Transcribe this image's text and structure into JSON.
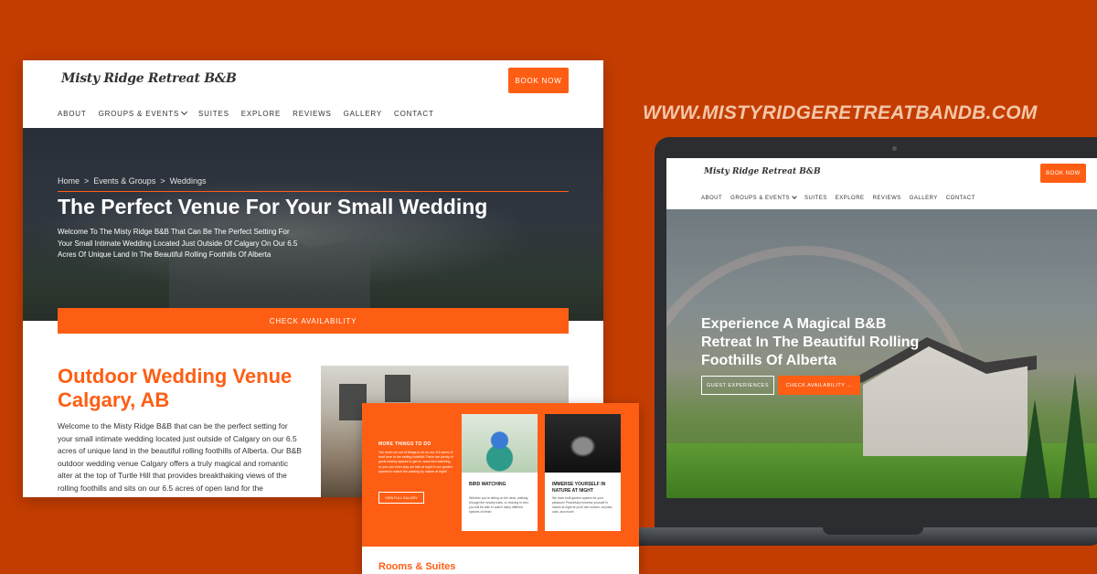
{
  "site_url": "WWW.MISTYRIDGERETREATBANDB.COM",
  "colors": {
    "background": "#c43d00",
    "accent": "#fe5e14",
    "url_text": "#f4c7a8"
  },
  "main_page": {
    "logo": "Misty Ridge Retreat B&B",
    "book_button": "BOOK NOW",
    "nav": [
      "ABOUT",
      "GROUPS & EVENTS",
      "SUITES",
      "EXPLORE",
      "REVIEWS",
      "GALLERY",
      "CONTACT"
    ],
    "breadcrumb": [
      "Home",
      ">",
      "Events & Groups",
      ">",
      "Weddings"
    ],
    "hero_title": "The Perfect Venue For Your Small Wedding",
    "hero_intro": "Welcome To The Misty Ridge B&B That Can Be The Perfect Setting For Your Small Intimate Wedding Located Just Outside Of Calgary On Our 6.5 Acres Of Unique Land In The Beautiful Rolling Foothills Of Alberta",
    "check_availability": "CHECK AVAILABILITY",
    "section_title": "Outdoor Wedding Venue Calgary, AB",
    "section_body": "Welcome to the Misty Ridge B&B that can be the perfect setting for your small intimate wedding located just outside of Calgary on our 6.5 acres of unique land in the beautiful rolling foothills of Alberta. Our B&B outdoor wedding venue Calgary offers a truly magical and romantic alter at the top of Turtle Hill that provides breakthaking views of the rolling foothills and sits on our 6.5 acres of open land for the"
  },
  "laptop_page": {
    "logo": "Misty Ridge Retreat B&B",
    "book_button": "BOOK NOW",
    "nav": [
      "ABOUT",
      "GROUPS & EVENTS",
      "SUITES",
      "EXPLORE",
      "REVIEWS",
      "GALLERY",
      "CONTACT"
    ],
    "hero_title": "Experience A Magical B&B Retreat In The Beautiful Rolling Foothills Of Alberta",
    "guest_button": "GUEST EXPERIENCES",
    "check_button": "CHECK AVAILABILITY →"
  },
  "overlay_page": {
    "heading": "MORE THINGS TO DO",
    "text": "You wont run out of things to do on our 6.5 acres of land here in the setting foothills! There are plenty of great nearby spaces to get to, www bird watching, or you can even stay out late at night in our garden spaces to watch the passing by nature at night!",
    "gallery_button": "VIEW FULL GALLERY",
    "cards": [
      {
        "title": "BIRD WATCHING",
        "text": "Whether you're sitting on the deck, walking through the nearby trails, or relaxing in bed, you will be able to watch many different species of birds!"
      },
      {
        "title": "IMMERSE YOURSELF IN NATURE AT NIGHT",
        "text": "We have built garden spaces for your pleasure! Peacefully immerse yourself in nature at night at you'll see wolves, coyotes, owls, and more!"
      }
    ],
    "rooms_title": "Rooms & Suites"
  }
}
